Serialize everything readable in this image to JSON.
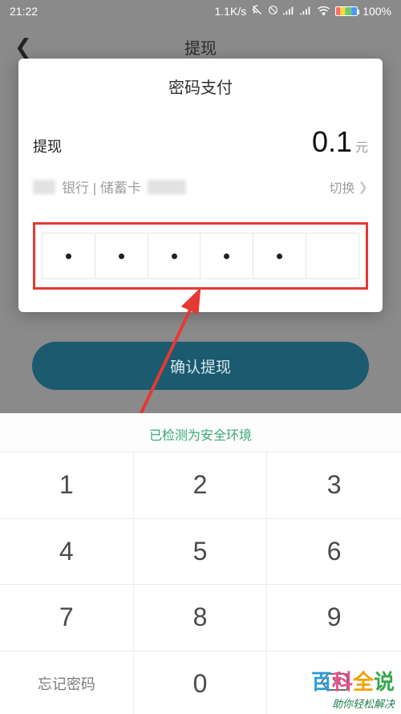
{
  "status": {
    "time": "21:22",
    "speed": "1.1K/s",
    "battery_pct": "100%"
  },
  "bg": {
    "title": "提现"
  },
  "modal": {
    "title": "密码支付",
    "amount_label": "提现",
    "amount_value": "0.1",
    "amount_unit": "元",
    "bank_mid": "银行 | 储蓄卡",
    "switch_text": "切换",
    "pin_entered": 5
  },
  "confirm": {
    "label": "确认提现"
  },
  "keypad": {
    "safe_env": "已检测为安全环境",
    "keys": [
      "1",
      "2",
      "3",
      "4",
      "5",
      "6",
      "7",
      "8",
      "9"
    ],
    "forgot": "忘记密码",
    "zero": "0"
  },
  "watermark": {
    "main": "百科全说",
    "sub": "助你轻松解决"
  },
  "colors": {
    "accent_red": "#e53935",
    "teal": "#1b5a6f",
    "safe_green": "#3aa87a"
  }
}
